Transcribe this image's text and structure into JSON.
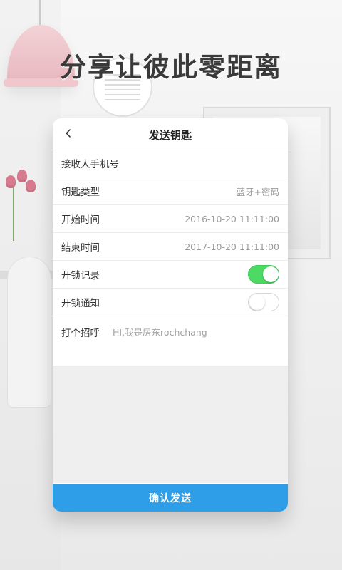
{
  "headline": "分享让彼此零距离",
  "screen": {
    "title": "发送钥匙",
    "back_icon": "chevron-left-icon",
    "rows": [
      {
        "label": "接收人手机号",
        "value": ""
      },
      {
        "label": "钥匙类型",
        "value": "蓝牙+密码"
      },
      {
        "label": "开始时间",
        "value": "2016-10-20 11:11:00"
      },
      {
        "label": "结束时间",
        "value": "2017-10-20 11:11:00"
      },
      {
        "label": "开锁记录",
        "toggle": true
      },
      {
        "label": "开锁通知",
        "toggle": false
      },
      {
        "label": "打个招呼",
        "placeholder": "HI,我是房东rochchang"
      }
    ],
    "confirm_label": "确认发送"
  },
  "colors": {
    "accent": "#2e9ee8",
    "toggle_on": "#4cd964"
  }
}
